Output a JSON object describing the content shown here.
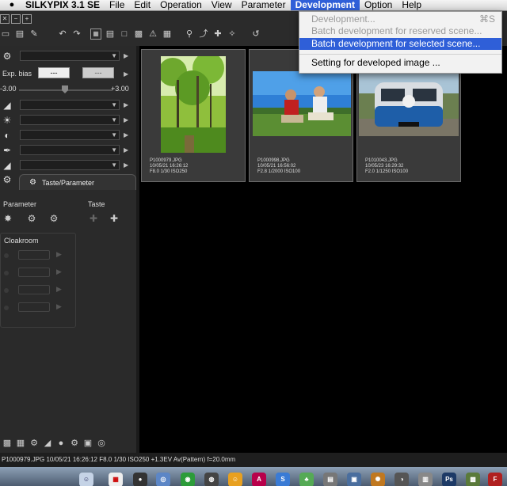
{
  "menubar": {
    "apple": "",
    "app_name": "SILKYPIX 3.1 SE",
    "items": [
      "File",
      "Edit",
      "Operation",
      "View",
      "Parameter",
      "Development",
      "Option",
      "Help"
    ]
  },
  "dropdown": {
    "items": [
      {
        "label": "Development...",
        "shortcut": "⌘S",
        "enabled": false
      },
      {
        "label": "Batch development for reserved scene...",
        "shortcut": "",
        "enabled": false
      },
      {
        "label": "Batch development for selected scene...",
        "shortcut": "",
        "enabled": true,
        "highlighted": true
      },
      {
        "label": "Setting for developed image ...",
        "shortcut": "",
        "enabled": true
      }
    ]
  },
  "left_panel": {
    "exp_bias_label": "Exp. bias",
    "exp_bias_value": "---",
    "exp_bias_value2": "---",
    "slider_min": "-3.00",
    "slider_max": "+3.00",
    "tab_label": "Taste/Parameter",
    "parameter_label": "Parameter",
    "taste_label": "Taste",
    "cloakroom_label": "Cloakroom"
  },
  "thumbnails": [
    {
      "filename": "P1000979.JPG",
      "datetime": "10/05/21 16:26:12",
      "exposure": "F8.0 1/30 ISO250"
    },
    {
      "filename": "P1000998.JPG",
      "datetime": "10/05/21 16:56:02",
      "exposure": "F2.8 1/2000 ISO100"
    },
    {
      "filename": "P1010043.JPG",
      "datetime": "10/05/23 16:29:32",
      "exposure": "F2.0 1/1250 ISO100"
    }
  ],
  "statusbar": {
    "text": "P1000979.JPG 10/05/21 16:26:12 F8.0 1/30 ISO250 +1.3EV Av(Pattern) f=20.0mm"
  },
  "colors": {
    "menu_highlight": "#2f5fd8",
    "panel_bg": "#2a2a2a",
    "thumb_bg": "#3a3a3a"
  }
}
